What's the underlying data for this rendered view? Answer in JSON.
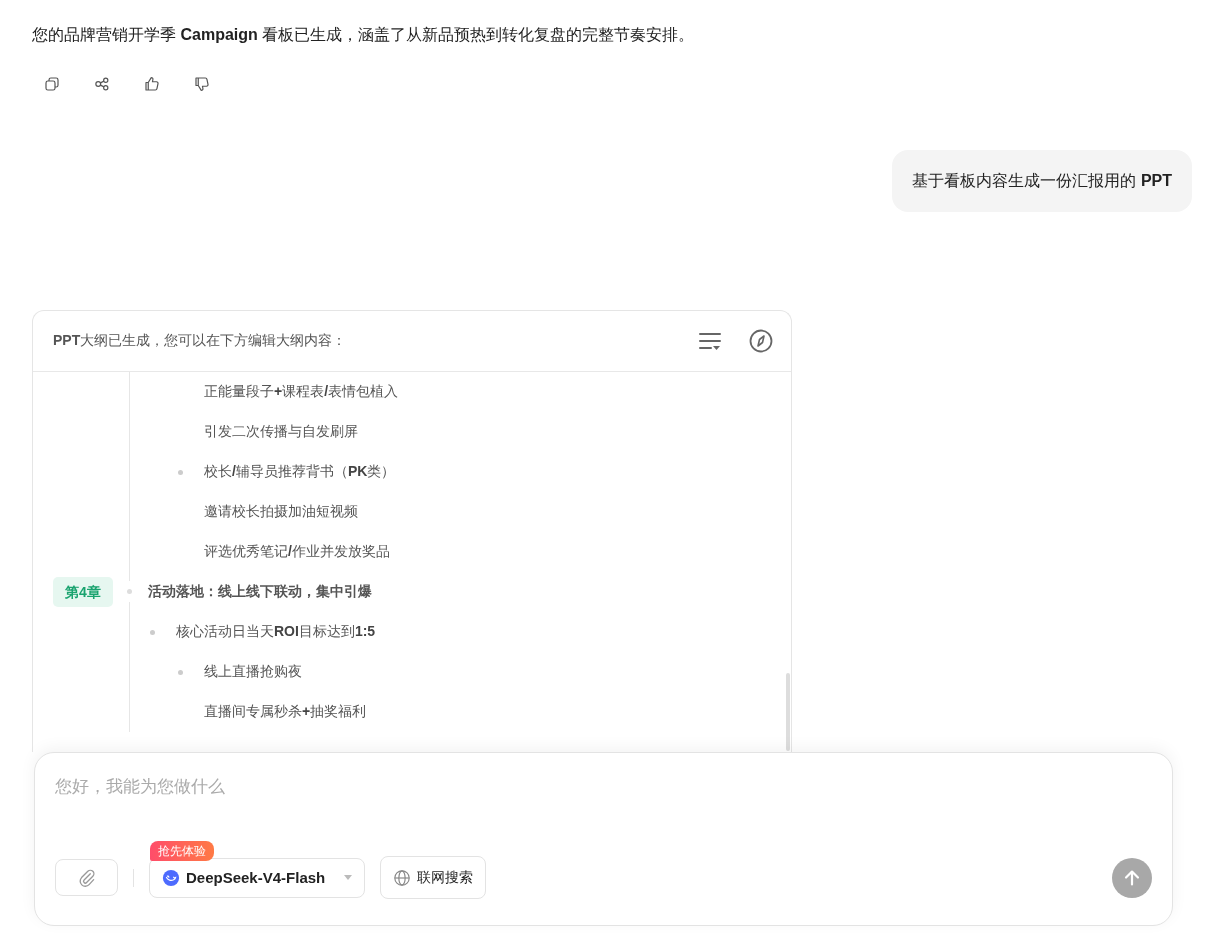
{
  "assistant_message": {
    "text": "您的品牌营销开学季 **Campaign** 看板已生成，涵盖了从新品预热到转化复盘的完整节奏安排。",
    "actions": [
      {
        "kind": "copy"
      },
      {
        "kind": "share"
      },
      {
        "kind": "like"
      },
      {
        "kind": "dislike"
      }
    ]
  },
  "user_message": {
    "text": "基于看板内容生成一份汇报用的 **PPT**"
  },
  "outline_panel": {
    "header": "**PPT**大纲已生成，您可以在下方编辑大纲内容：",
    "items": [
      {
        "kind": "fragment",
        "children": [
          {
            "kind": "fragment",
            "children": [
              {
                "kind": "note",
                "text": "正能量段子**+**课程表**/**表情包植入"
              },
              {
                "kind": "note",
                "text": "引发二次传播与自发刷屏"
              },
              {
                "kind": "bullet",
                "text": "校长**/**辅导员推荐背书（**PK**类）"
              },
              {
                "kind": "note",
                "text": "邀请校长拍摄加油短视频"
              },
              {
                "kind": "note",
                "text": "评选优秀笔记**/**作业并发放奖品"
              }
            ]
          }
        ]
      },
      {
        "kind": "chapter",
        "badge": "第4章",
        "text": "活动落地：线上线下联动，集中引爆",
        "children": [
          {
            "kind": "bullet",
            "text": "核心活动日当天**ROI**目标达到**1:5**",
            "children": [
              {
                "kind": "bullet",
                "text": "线上直播抢购夜"
              },
              {
                "kind": "note",
                "text": "直播间专属秒杀**+**抽奖福利"
              }
            ]
          }
        ]
      }
    ]
  },
  "composer": {
    "placeholder": "您好，我能为您做什么",
    "model": {
      "name": "DeepSeek-V4-Flash",
      "badge": "抢先体验"
    },
    "search_button": {
      "label": "联网搜索",
      "selected": false
    },
    "send_button": {
      "disabled": true
    }
  }
}
